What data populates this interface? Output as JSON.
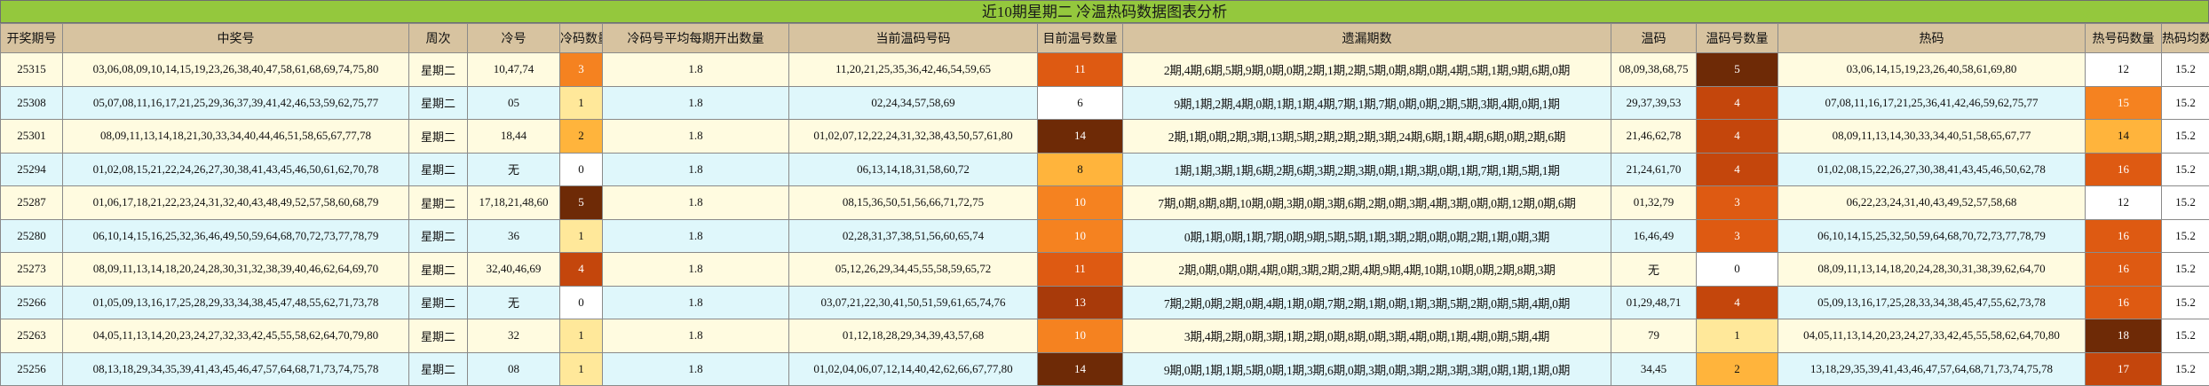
{
  "title": "近10期星期二 冷温热码数据图表分析",
  "headers": [
    "开奖期号",
    "中奖号",
    "周次",
    "冷号",
    "冷码数量",
    "冷码号平均每期开出数量",
    "当前温码号码",
    "目前温号数量",
    "遗漏期数",
    "温码",
    "温码号数量",
    "热码",
    "热号码数量",
    "热码均数"
  ],
  "colors": {
    "header_bg": "#d7c3a0",
    "title_bg": "#94c83d",
    "row_odd": "#fffbe0",
    "row_even": "#dff7fb",
    "heat_scale": [
      "#ffffff",
      "#ffe89a",
      "#ffb43c",
      "#f58220",
      "#de5a12",
      "#c4460c",
      "#a83a0a",
      "#6e2a06"
    ]
  },
  "rows": [
    {
      "period": "25315",
      "winning": "03,06,08,09,10,14,15,19,23,26,38,40,47,58,61,68,69,74,75,80",
      "weekday": "星期二",
      "cold": "10,47,74",
      "cold_count": "3",
      "cold_avg": "1.8",
      "warm_numbers": "11,20,21,25,35,36,42,46,54,59,65",
      "warm_count": "11",
      "missing": "2期,4期,6期,5期,9期,0期,0期,2期,1期,2期,5期,0期,8期,0期,4期,5期,1期,9期,6期,0期",
      "warm": "08,09,38,68,75",
      "warm_num_count": "5",
      "hot": "03,06,14,15,19,23,26,40,58,61,69,80",
      "hot_count": "12",
      "hot_avg": "15.2"
    },
    {
      "period": "25308",
      "winning": "05,07,08,11,16,17,21,25,29,36,37,39,41,42,46,53,59,62,75,77",
      "weekday": "星期二",
      "cold": "05",
      "cold_count": "1",
      "cold_avg": "1.8",
      "warm_numbers": "02,24,34,57,58,69",
      "warm_count": "6",
      "missing": "9期,1期,2期,4期,0期,1期,1期,4期,7期,1期,7期,0期,0期,2期,5期,3期,4期,0期,1期",
      "warm": "29,37,39,53",
      "warm_num_count": "4",
      "hot": "07,08,11,16,17,21,25,36,41,42,46,59,62,75,77",
      "hot_count": "15",
      "hot_avg": "15.2"
    },
    {
      "period": "25301",
      "winning": "08,09,11,13,14,18,21,30,33,34,40,44,46,51,58,65,67,77,78",
      "weekday": "星期二",
      "cold": "18,44",
      "cold_count": "2",
      "cold_avg": "1.8",
      "warm_numbers": "01,02,07,12,22,24,31,32,38,43,50,57,61,80",
      "warm_count": "14",
      "missing": "2期,1期,0期,2期,3期,13期,5期,2期,2期,2期,3期,24期,6期,1期,4期,6期,0期,2期,6期",
      "warm": "21,46,62,78",
      "warm_num_count": "4",
      "hot": "08,09,11,13,14,30,33,34,40,51,58,65,67,77",
      "hot_count": "14",
      "hot_avg": "15.2"
    },
    {
      "period": "25294",
      "winning": "01,02,08,15,21,22,24,26,27,30,38,41,43,45,46,50,61,62,70,78",
      "weekday": "星期二",
      "cold": "无",
      "cold_count": "0",
      "cold_avg": "1.8",
      "warm_numbers": "06,13,14,18,31,58,60,72",
      "warm_count": "8",
      "missing": "1期,1期,3期,1期,6期,2期,6期,3期,2期,3期,0期,1期,3期,0期,1期,7期,1期,5期,1期",
      "warm": "21,24,61,70",
      "warm_num_count": "4",
      "hot": "01,02,08,15,22,26,27,30,38,41,43,45,46,50,62,78",
      "hot_count": "16",
      "hot_avg": "15.2"
    },
    {
      "period": "25287",
      "winning": "01,06,17,18,21,22,23,24,31,32,40,43,48,49,52,57,58,60,68,79",
      "weekday": "星期二",
      "cold": "17,18,21,48,60",
      "cold_count": "5",
      "cold_avg": "1.8",
      "warm_numbers": "08,15,36,50,51,56,66,71,72,75",
      "warm_count": "10",
      "missing": "7期,0期,8期,8期,10期,0期,3期,0期,3期,6期,2期,0期,3期,4期,3期,0期,0期,12期,0期,6期",
      "warm": "01,32,79",
      "warm_num_count": "3",
      "hot": "06,22,23,24,31,40,43,49,52,57,58,68",
      "hot_count": "12",
      "hot_avg": "15.2"
    },
    {
      "period": "25280",
      "winning": "06,10,14,15,16,25,32,36,46,49,50,59,64,68,70,72,73,77,78,79",
      "weekday": "星期二",
      "cold": "36",
      "cold_count": "1",
      "cold_avg": "1.8",
      "warm_numbers": "02,28,31,37,38,51,56,60,65,74",
      "warm_count": "10",
      "missing": "0期,1期,0期,1期,7期,0期,9期,5期,5期,1期,3期,2期,0期,0期,2期,1期,0期,3期",
      "warm": "16,46,49",
      "warm_num_count": "3",
      "hot": "06,10,14,15,25,32,50,59,64,68,70,72,73,77,78,79",
      "hot_count": "16",
      "hot_avg": "15.2"
    },
    {
      "period": "25273",
      "winning": "08,09,11,13,14,18,20,24,28,30,31,32,38,39,40,46,62,64,69,70",
      "weekday": "星期二",
      "cold": "32,40,46,69",
      "cold_count": "4",
      "cold_avg": "1.8",
      "warm_numbers": "05,12,26,29,34,45,55,58,59,65,72",
      "warm_count": "11",
      "missing": "2期,0期,0期,0期,4期,0期,3期,2期,2期,4期,9期,4期,10期,10期,0期,2期,8期,3期",
      "warm": "无",
      "warm_num_count": "0",
      "hot": "08,09,11,13,14,18,20,24,28,30,31,38,39,62,64,70",
      "hot_count": "16",
      "hot_avg": "15.2"
    },
    {
      "period": "25266",
      "winning": "01,05,09,13,16,17,25,28,29,33,34,38,45,47,48,55,62,71,73,78",
      "weekday": "星期二",
      "cold": "无",
      "cold_count": "0",
      "cold_avg": "1.8",
      "warm_numbers": "03,07,21,22,30,41,50,51,59,61,65,74,76",
      "warm_count": "13",
      "missing": "7期,2期,0期,2期,0期,4期,1期,0期,7期,2期,1期,0期,1期,3期,5期,2期,0期,5期,4期,0期",
      "warm": "01,29,48,71",
      "warm_num_count": "4",
      "hot": "05,09,13,16,17,25,28,33,34,38,45,47,55,62,73,78",
      "hot_count": "16",
      "hot_avg": "15.2"
    },
    {
      "period": "25263",
      "winning": "04,05,11,13,14,20,23,24,27,32,33,42,45,55,58,62,64,70,79,80",
      "weekday": "星期二",
      "cold": "32",
      "cold_count": "1",
      "cold_avg": "1.8",
      "warm_numbers": "01,12,18,28,29,34,39,43,57,68",
      "warm_count": "10",
      "missing": "3期,4期,2期,0期,3期,1期,2期,0期,8期,0期,3期,4期,0期,1期,4期,0期,5期,4期",
      "warm": "79",
      "warm_num_count": "1",
      "hot": "04,05,11,13,14,20,23,24,27,33,42,45,55,58,62,64,70,80",
      "hot_count": "18",
      "hot_avg": "15.2"
    },
    {
      "period": "25256",
      "winning": "08,13,18,29,34,35,39,41,43,45,46,47,57,64,68,71,73,74,75,78",
      "weekday": "星期二",
      "cold": "08",
      "cold_count": "1",
      "cold_avg": "1.8",
      "warm_numbers": "01,02,04,06,07,12,14,40,42,62,66,67,77,80",
      "warm_count": "14",
      "missing": "9期,0期,1期,1期,5期,0期,1期,3期,6期,0期,3期,0期,3期,2期,3期,3期,0期,1期,1期,0期",
      "warm": "34,45",
      "warm_num_count": "2",
      "hot": "13,18,29,35,39,41,43,46,47,57,64,68,71,73,74,75,78",
      "hot_count": "17",
      "hot_avg": "15.2"
    }
  ]
}
